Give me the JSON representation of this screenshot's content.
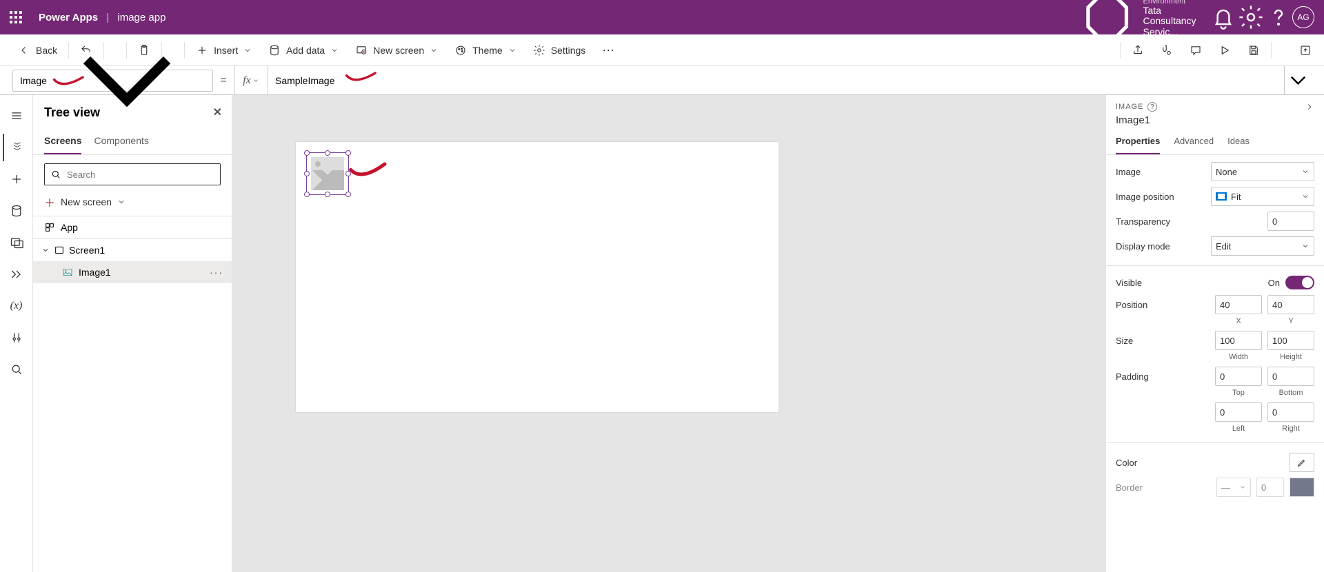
{
  "header": {
    "product": "Power Apps",
    "app_name": "image app",
    "env_label": "Environment",
    "env_value": "Tata Consultancy Servic...",
    "avatar": "AG"
  },
  "cmdbar": {
    "back": "Back",
    "insert": "Insert",
    "add_data": "Add data",
    "new_screen": "New screen",
    "theme": "Theme",
    "settings": "Settings"
  },
  "formula": {
    "property": "Image",
    "expression": "SampleImage"
  },
  "tree": {
    "title": "Tree view",
    "tab_screens": "Screens",
    "tab_components": "Components",
    "search_placeholder": "Search",
    "new_screen": "New screen",
    "app": "App",
    "screen": "Screen1",
    "image_item": "Image1"
  },
  "props": {
    "type_label": "IMAGE",
    "control_name": "Image1",
    "tab_properties": "Properties",
    "tab_advanced": "Advanced",
    "tab_ideas": "Ideas",
    "image_lbl": "Image",
    "image_val": "None",
    "imgpos_lbl": "Image position",
    "imgpos_val": "Fit",
    "transparency_lbl": "Transparency",
    "transparency_val": "0",
    "display_lbl": "Display mode",
    "display_val": "Edit",
    "visible_lbl": "Visible",
    "visible_val": "On",
    "position_lbl": "Position",
    "pos_x": "40",
    "pos_y": "40",
    "pos_x_lbl": "X",
    "pos_y_lbl": "Y",
    "size_lbl": "Size",
    "size_w": "100",
    "size_h": "100",
    "size_w_lbl": "Width",
    "size_h_lbl": "Height",
    "padding_lbl": "Padding",
    "pad_top": "0",
    "pad_bottom": "0",
    "pad_left": "0",
    "pad_right": "0",
    "pad_top_lbl": "Top",
    "pad_bottom_lbl": "Bottom",
    "pad_left_lbl": "Left",
    "pad_right_lbl": "Right",
    "color_lbl": "Color",
    "border_lbl": "Border",
    "border_val": "0"
  }
}
